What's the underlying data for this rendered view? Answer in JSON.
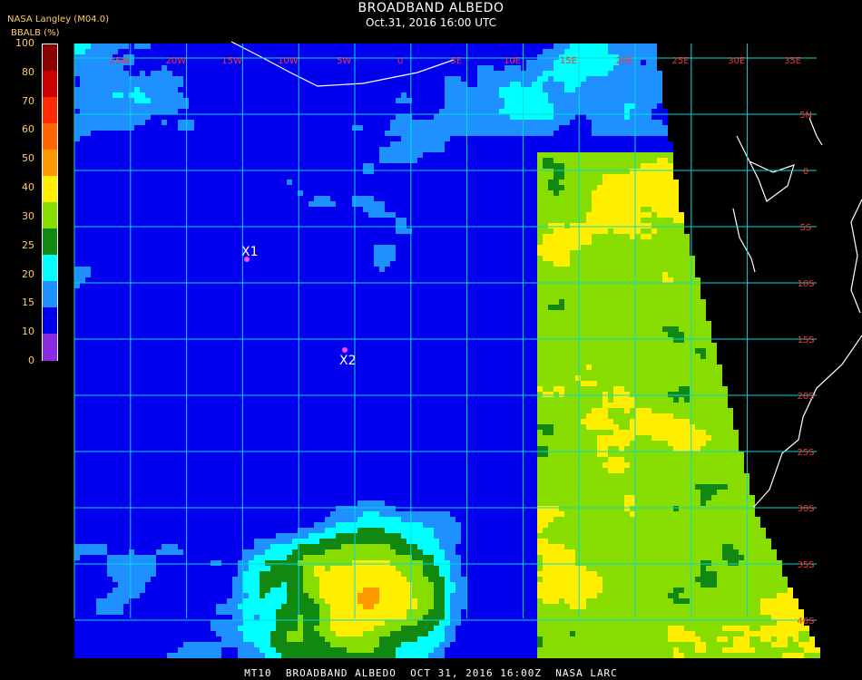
{
  "header": {
    "title": "BROADBAND ALBEDO",
    "subtitle": "Oct.31, 2016 16:00 UTC",
    "agency": "NASA Langley (M04.0)",
    "unit": "BBALB (%)"
  },
  "footer": {
    "text": "MT10  BROADBAND ALBEDO  OCT 31, 2016 16:00Z  NASA LARC"
  },
  "colorbar": {
    "ticks": [
      "100",
      "80",
      "70",
      "60",
      "50",
      "40",
      "30",
      "25",
      "20",
      "15",
      "10",
      "0"
    ],
    "values": [
      100,
      80,
      70,
      60,
      50,
      40,
      30,
      25,
      20,
      15,
      10,
      0
    ],
    "colors": [
      "#8b0000",
      "#cc0000",
      "#ff2a00",
      "#ff6600",
      "#ff9900",
      "#ffee00",
      "#88dd00",
      "#118811",
      "#00ffff",
      "#1e90ff",
      "#0000ee",
      "#8a2be2"
    ]
  },
  "map": {
    "lon_labels": [
      "25W",
      "20W",
      "15W",
      "10W",
      "5W",
      "0",
      "5E",
      "10E",
      "15E",
      "20E",
      "25E",
      "30E",
      "35E"
    ],
    "lat_labels": [
      "5N",
      "0",
      "5S",
      "10S",
      "15S",
      "20S",
      "25S",
      "30S",
      "35S",
      "40S"
    ],
    "grid_color": "#00dddd",
    "label_color": "#ff3333",
    "markers": [
      {
        "label": "X1",
        "color": "#ff44ff"
      },
      {
        "label": "X2",
        "color": "#ff44ff"
      }
    ]
  }
}
